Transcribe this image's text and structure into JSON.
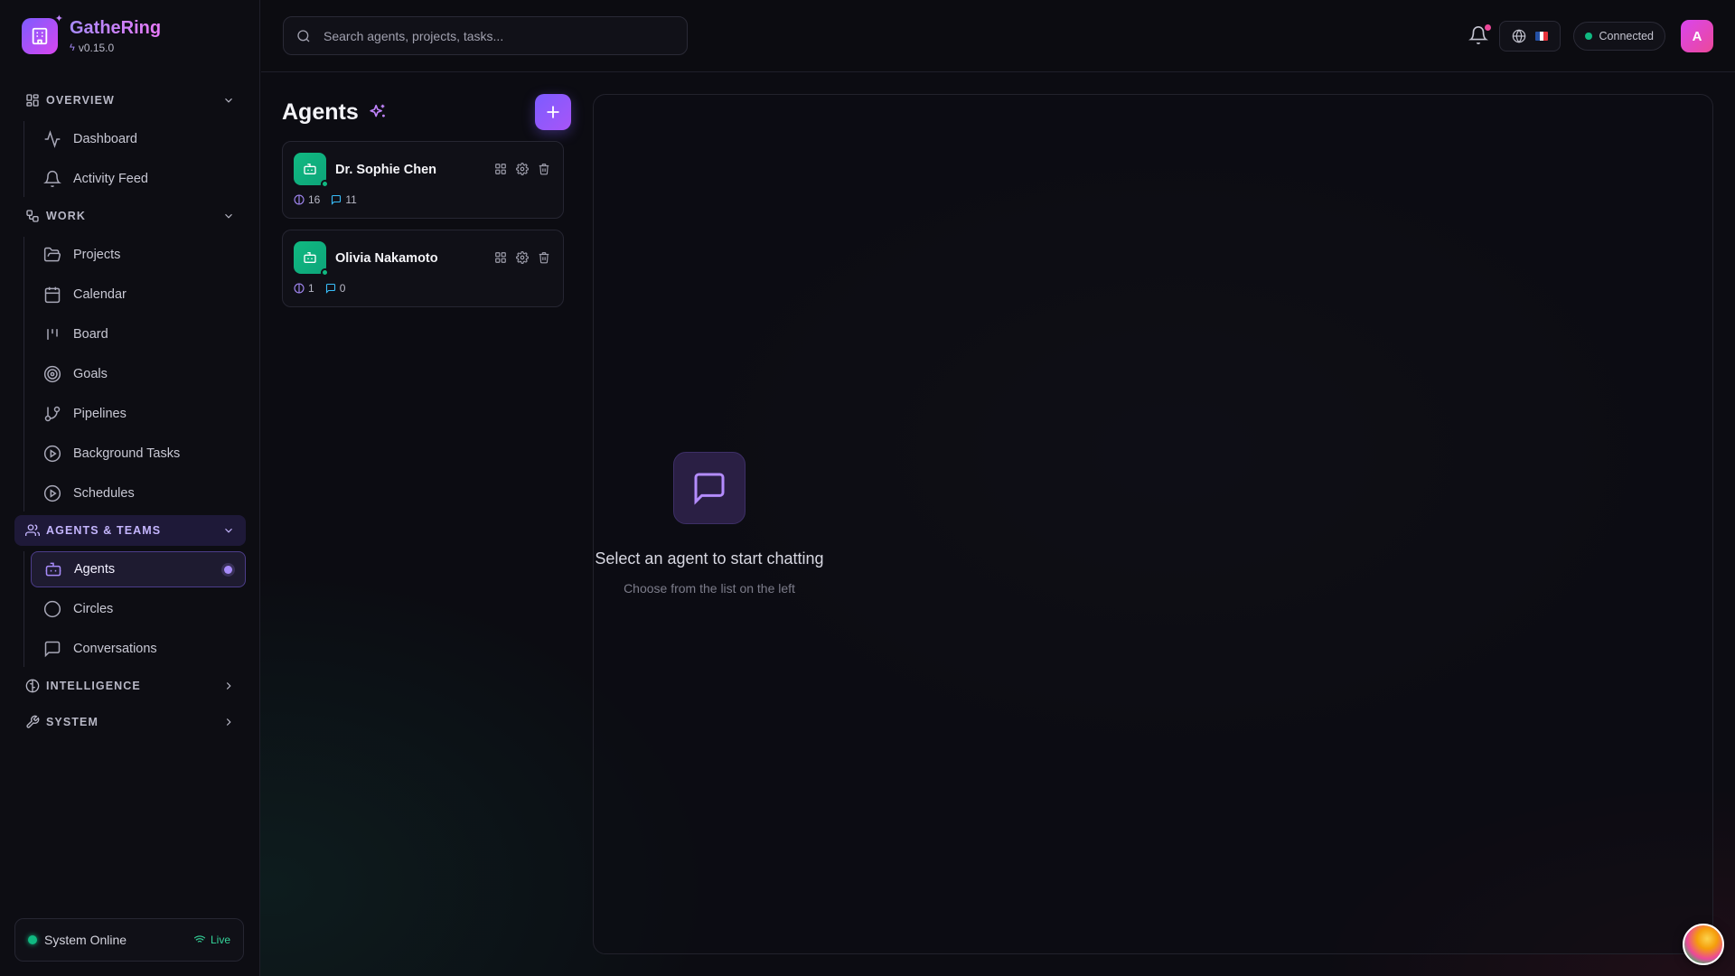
{
  "app": {
    "name": "GatheRing",
    "version": "v0.15.0"
  },
  "search": {
    "placeholder": "Search agents, projects, tasks..."
  },
  "header": {
    "connection_status": "Connected",
    "avatar_letter": "A",
    "flag_icon": "flag-fr-icon"
  },
  "sidebar": {
    "sections": {
      "overview": "OVERVIEW",
      "work": "WORK",
      "agents_teams": "AGENTS & TEAMS",
      "intelligence": "INTELLIGENCE",
      "system": "SYSTEM"
    },
    "items": {
      "dashboard": "Dashboard",
      "activity_feed": "Activity Feed",
      "projects": "Projects",
      "calendar": "Calendar",
      "board": "Board",
      "goals": "Goals",
      "pipelines": "Pipelines",
      "background_tasks": "Background Tasks",
      "schedules": "Schedules",
      "agents": "Agents",
      "circles": "Circles",
      "conversations": "Conversations"
    },
    "footer": {
      "status": "System Online",
      "live": "Live"
    }
  },
  "agents_panel": {
    "title": "Agents",
    "agents": [
      {
        "name": "Dr. Sophie Chen",
        "memories": "16",
        "messages": "11",
        "online": true
      },
      {
        "name": "Olivia Nakamoto",
        "memories": "1",
        "messages": "0",
        "online": true
      }
    ]
  },
  "chat": {
    "empty_title": "Select an agent to start chatting",
    "empty_subtitle": "Choose from the list on the left"
  },
  "colors": {
    "accent": "#7c5cff",
    "accent_pink": "#d946ef",
    "agent_green": "#10b981",
    "status_green": "#10b981",
    "notification_badge": "#ec4899"
  }
}
